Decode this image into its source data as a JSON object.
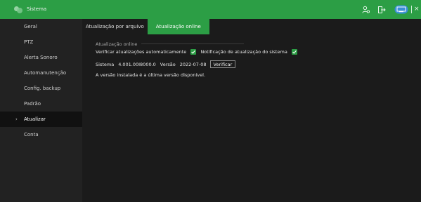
{
  "app": {
    "title": "Sistema",
    "accent": "#2c9e45"
  },
  "header_icons": [
    "user-icon",
    "logout-icon",
    "display-icon",
    "close-icon"
  ],
  "header": {
    "close_glyph": "×"
  },
  "sidebar": {
    "items": [
      {
        "label": "Geral",
        "active": false
      },
      {
        "label": "PTZ",
        "active": false
      },
      {
        "label": "Alerta Sonoro",
        "active": false
      },
      {
        "label": "Automanutenção",
        "active": false
      },
      {
        "label": "Config. backup",
        "active": false
      },
      {
        "label": "Padrão",
        "active": false
      },
      {
        "label": "Atualizar",
        "active": true,
        "chevron": "›"
      },
      {
        "label": "Conta",
        "active": false
      }
    ]
  },
  "tabs": [
    {
      "label": "Atualização por arquivo",
      "active": false
    },
    {
      "label": "Atualização online",
      "active": true
    }
  ],
  "online": {
    "section_title": "Atualização online",
    "auto_check_label": "Verificar atualizações automaticamente",
    "auto_check_checked": true,
    "notify_label": "Notificação de atualização do sistema",
    "notify_checked": true,
    "system_label": "Sistema",
    "system_value": "4.001.00I8000.0",
    "version_label": "Versão",
    "version_value": "2022-07-08",
    "verify_button": "Verificar",
    "status_message": "A versão instalada é a última versão disponível."
  }
}
